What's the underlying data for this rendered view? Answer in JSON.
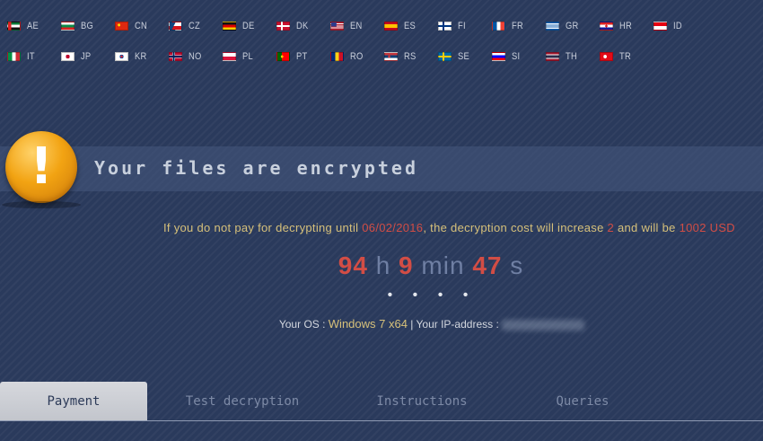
{
  "languages_row1": [
    {
      "code": "AE",
      "flag": "ae-flag"
    },
    {
      "code": "BG",
      "flag": "bg-flag"
    },
    {
      "code": "CN",
      "flag": "cn-flag"
    },
    {
      "code": "CZ",
      "flag": "cz-flag"
    },
    {
      "code": "DE",
      "flag": "de-flag"
    },
    {
      "code": "DK",
      "flag": "dk-flag"
    },
    {
      "code": "EN",
      "flag": "us-flag"
    },
    {
      "code": "ES",
      "flag": "es-flag"
    },
    {
      "code": "FI",
      "flag": "fi-flag"
    },
    {
      "code": "FR",
      "flag": "fr-flag"
    },
    {
      "code": "GR",
      "flag": "gr-flag"
    },
    {
      "code": "HR",
      "flag": "hr-flag"
    },
    {
      "code": "ID",
      "flag": "id-flag"
    }
  ],
  "languages_row2": [
    {
      "code": "IT",
      "flag": "it-flag"
    },
    {
      "code": "JP",
      "flag": "jp-flag"
    },
    {
      "code": "KR",
      "flag": "kr-flag"
    },
    {
      "code": "NO",
      "flag": "no-flag"
    },
    {
      "code": "PL",
      "flag": "pl-flag"
    },
    {
      "code": "PT",
      "flag": "pt-flag"
    },
    {
      "code": "RO",
      "flag": "ro-flag"
    },
    {
      "code": "RS",
      "flag": "rs-flag"
    },
    {
      "code": "SE",
      "flag": "se-flag"
    },
    {
      "code": "SI",
      "flag": "si-flag"
    },
    {
      "code": "TH",
      "flag": "th-flag"
    },
    {
      "code": "TR",
      "flag": "tr-flag"
    }
  ],
  "banner": {
    "icon": "exclamation-icon",
    "mark": "!",
    "title": "Your files are encrypted"
  },
  "deadline": {
    "prefix": "If you do not pay for decrypting until ",
    "date": "06/02/2016",
    "middle": ", the decryption cost will increase ",
    "increase": "2",
    "suffix": " and will be ",
    "amount": "1002 USD"
  },
  "timer": {
    "hours": "94",
    "hours_unit": "h",
    "minutes": "9",
    "minutes_unit": "min",
    "seconds": "47",
    "seconds_unit": "s"
  },
  "dots": "• • • •",
  "system": {
    "os_label": "Your OS : ",
    "os_value": "Windows 7 x64",
    "ip_label": " | Your IP-address : "
  },
  "tabs": [
    {
      "label": "Payment",
      "active": true
    },
    {
      "label": "Test decryption",
      "active": false
    },
    {
      "label": "Instructions",
      "active": false
    },
    {
      "label": "Queries",
      "active": false
    }
  ],
  "colors": {
    "background": "#2a3a5c",
    "accent_red": "#d24d45",
    "accent_gold": "#d6c07a",
    "icon_orange": "#f2a312"
  }
}
